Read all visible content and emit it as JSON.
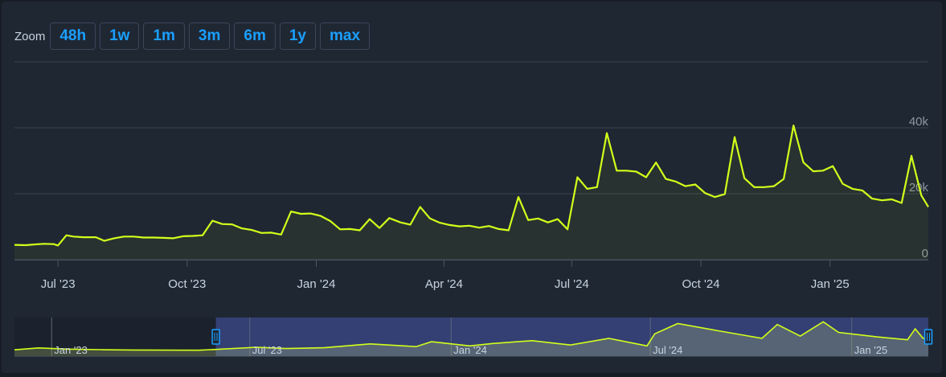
{
  "zoom": {
    "label": "Zoom",
    "buttons": [
      "48h",
      "1w",
      "1m",
      "3m",
      "6m",
      "1y",
      "max"
    ]
  },
  "colors": {
    "line": "#d2ff1a",
    "grid": "#3a4350",
    "tick": "#8f98a0",
    "axis_label": "#c6d4df",
    "navigator_mask": "#3d4a8c",
    "handle": "#1a9fff"
  },
  "chart_data": {
    "type": "line",
    "x_unit": "date",
    "ylim": [
      0,
      40000
    ],
    "y_ticks": [
      0,
      20000,
      40000
    ],
    "y_tick_labels": [
      "0",
      "20k",
      "40k"
    ],
    "grid": true,
    "x_ticks": [
      {
        "date": "2023-07-01",
        "label": "Jul '23"
      },
      {
        "date": "2023-10-01",
        "label": "Oct '23"
      },
      {
        "date": "2024-01-01",
        "label": "Jan '24"
      },
      {
        "date": "2024-04-01",
        "label": "Apr '24"
      },
      {
        "date": "2024-07-01",
        "label": "Jul '24"
      },
      {
        "date": "2024-10-01",
        "label": "Oct '24"
      },
      {
        "date": "2025-01-01",
        "label": "Jan '25"
      }
    ],
    "series": [
      {
        "points": [
          [
            "2023-05-31",
            4500
          ],
          [
            "2023-06-08",
            4400
          ],
          [
            "2023-06-14",
            4600
          ],
          [
            "2023-06-21",
            4800
          ],
          [
            "2023-06-28",
            4700
          ],
          [
            "2023-07-01",
            4300
          ],
          [
            "2023-07-07",
            7400
          ],
          [
            "2023-07-12",
            7000
          ],
          [
            "2023-07-19",
            6800
          ],
          [
            "2023-07-28",
            6800
          ],
          [
            "2023-08-03",
            5700
          ],
          [
            "2023-08-10",
            6500
          ],
          [
            "2023-08-17",
            7000
          ],
          [
            "2023-08-24",
            7000
          ],
          [
            "2023-08-31",
            6700
          ],
          [
            "2023-09-07",
            6700
          ],
          [
            "2023-09-14",
            6600
          ],
          [
            "2023-09-21",
            6500
          ],
          [
            "2023-09-28",
            7100
          ],
          [
            "2023-10-05",
            7200
          ],
          [
            "2023-10-12",
            7400
          ],
          [
            "2023-10-19",
            11800
          ],
          [
            "2023-10-26",
            10800
          ],
          [
            "2023-11-02",
            10700
          ],
          [
            "2023-11-09",
            9500
          ],
          [
            "2023-11-16",
            9000
          ],
          [
            "2023-11-23",
            8100
          ],
          [
            "2023-11-30",
            8200
          ],
          [
            "2023-12-07",
            7600
          ],
          [
            "2023-12-14",
            14600
          ],
          [
            "2023-12-21",
            13900
          ],
          [
            "2023-12-28",
            14000
          ],
          [
            "2024-01-04",
            13300
          ],
          [
            "2024-01-11",
            11700
          ],
          [
            "2024-01-18",
            9200
          ],
          [
            "2024-01-25",
            9300
          ],
          [
            "2024-02-01",
            8900
          ],
          [
            "2024-02-08",
            12300
          ],
          [
            "2024-02-15",
            9600
          ],
          [
            "2024-02-22",
            12600
          ],
          [
            "2024-03-01",
            11300
          ],
          [
            "2024-03-08",
            10600
          ],
          [
            "2024-03-15",
            16000
          ],
          [
            "2024-03-22",
            12500
          ],
          [
            "2024-03-29",
            11200
          ],
          [
            "2024-04-05",
            10500
          ],
          [
            "2024-04-12",
            10100
          ],
          [
            "2024-04-19",
            10300
          ],
          [
            "2024-04-26",
            9700
          ],
          [
            "2024-05-03",
            10200
          ],
          [
            "2024-05-10",
            9300
          ],
          [
            "2024-05-17",
            8900
          ],
          [
            "2024-05-24",
            19000
          ],
          [
            "2024-05-31",
            12000
          ],
          [
            "2024-06-07",
            12500
          ],
          [
            "2024-06-14",
            11300
          ],
          [
            "2024-06-21",
            12300
          ],
          [
            "2024-06-28",
            9200
          ],
          [
            "2024-07-05",
            25000
          ],
          [
            "2024-07-12",
            21500
          ],
          [
            "2024-07-19",
            22000
          ],
          [
            "2024-07-26",
            38400
          ],
          [
            "2024-08-02",
            27000
          ],
          [
            "2024-08-09",
            27000
          ],
          [
            "2024-08-16",
            26700
          ],
          [
            "2024-08-23",
            25000
          ],
          [
            "2024-08-30",
            29500
          ],
          [
            "2024-09-06",
            24500
          ],
          [
            "2024-09-13",
            23700
          ],
          [
            "2024-09-20",
            22300
          ],
          [
            "2024-09-27",
            22800
          ],
          [
            "2024-10-04",
            20200
          ],
          [
            "2024-10-11",
            19000
          ],
          [
            "2024-10-18",
            19900
          ],
          [
            "2024-10-25",
            37200
          ],
          [
            "2024-11-01",
            24700
          ],
          [
            "2024-11-08",
            22000
          ],
          [
            "2024-11-15",
            22000
          ],
          [
            "2024-11-22",
            22300
          ],
          [
            "2024-11-29",
            24500
          ],
          [
            "2024-12-06",
            40700
          ],
          [
            "2024-12-13",
            29500
          ],
          [
            "2024-12-20",
            26800
          ],
          [
            "2024-12-27",
            27000
          ],
          [
            "2025-01-03",
            28400
          ],
          [
            "2025-01-10",
            23000
          ],
          [
            "2025-01-17",
            21500
          ],
          [
            "2025-01-24",
            21000
          ],
          [
            "2025-01-31",
            18500
          ],
          [
            "2025-02-07",
            18000
          ],
          [
            "2025-02-14",
            18300
          ],
          [
            "2025-02-21",
            17200
          ],
          [
            "2025-02-28",
            31500
          ],
          [
            "2025-03-07",
            19500
          ],
          [
            "2025-03-12",
            16000
          ]
        ]
      }
    ],
    "navigator": {
      "selection": [
        "2023-05-31",
        "2025-03-12"
      ],
      "x_ticks": [
        {
          "date": "2023-01-01",
          "label": "Jan '23"
        },
        {
          "date": "2023-07-01",
          "label": "Jul '23"
        },
        {
          "date": "2024-01-01",
          "label": "Jan '24"
        },
        {
          "date": "2024-07-01",
          "label": "Jul '24"
        },
        {
          "date": "2025-01-01",
          "label": "Jan '25"
        }
      ],
      "points": [
        [
          "2022-11-28",
          4000
        ],
        [
          "2022-12-20",
          6500
        ],
        [
          "2023-01-15",
          5000
        ],
        [
          "2023-02-15",
          4200
        ],
        [
          "2023-03-15",
          3800
        ],
        [
          "2023-04-15",
          3600
        ],
        [
          "2023-05-15",
          3500
        ],
        [
          "2023-05-31",
          4500
        ],
        [
          "2023-07-07",
          7400
        ],
        [
          "2023-08-03",
          5700
        ],
        [
          "2023-09-07",
          6700
        ],
        [
          "2023-10-19",
          11800
        ],
        [
          "2023-11-30",
          8200
        ],
        [
          "2023-12-14",
          14600
        ],
        [
          "2024-01-18",
          9200
        ],
        [
          "2024-02-08",
          12300
        ],
        [
          "2024-03-15",
          16000
        ],
        [
          "2024-04-19",
          10300
        ],
        [
          "2024-05-24",
          19000
        ],
        [
          "2024-06-28",
          9200
        ],
        [
          "2024-07-05",
          25000
        ],
        [
          "2024-07-26",
          38400
        ],
        [
          "2024-08-30",
          29500
        ],
        [
          "2024-10-11",
          19000
        ],
        [
          "2024-10-25",
          37200
        ],
        [
          "2024-11-15",
          22000
        ],
        [
          "2024-12-06",
          40700
        ],
        [
          "2024-12-20",
          26800
        ],
        [
          "2025-01-24",
          21000
        ],
        [
          "2025-02-21",
          17200
        ],
        [
          "2025-02-28",
          31500
        ],
        [
          "2025-03-07",
          19500
        ],
        [
          "2025-03-12",
          16000
        ]
      ]
    }
  }
}
